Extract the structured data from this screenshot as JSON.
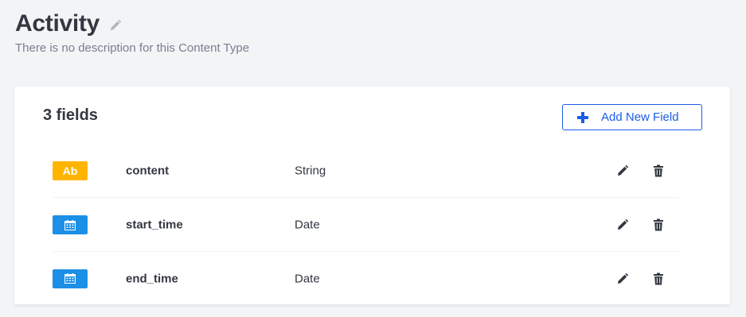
{
  "header": {
    "title": "Activity",
    "description": "There is no description for this Content Type",
    "edit_icon": "pencil-icon"
  },
  "fields_panel": {
    "count_label": "3 fields",
    "add_button_label": "Add New Field",
    "add_button_icon": "plus-icon"
  },
  "fields": [
    {
      "badge_text": "Ab",
      "badge_icon": "text-icon",
      "badge_color": "#ffb500",
      "name": "content",
      "type": "String"
    },
    {
      "badge_text": "",
      "badge_icon": "calendar-icon",
      "badge_color": "#1c8fe6",
      "name": "start_time",
      "type": "Date"
    },
    {
      "badge_text": "",
      "badge_icon": "calendar-icon",
      "badge_color": "#1c8fe6",
      "name": "end_time",
      "type": "Date"
    }
  ],
  "row_actions": {
    "edit_icon": "pencil-icon",
    "delete_icon": "trash-icon"
  },
  "colors": {
    "accent": "#1c5de7",
    "string_badge": "#ffb500",
    "date_badge": "#1c8fe6",
    "text": "#333740",
    "muted": "#787e8f"
  }
}
